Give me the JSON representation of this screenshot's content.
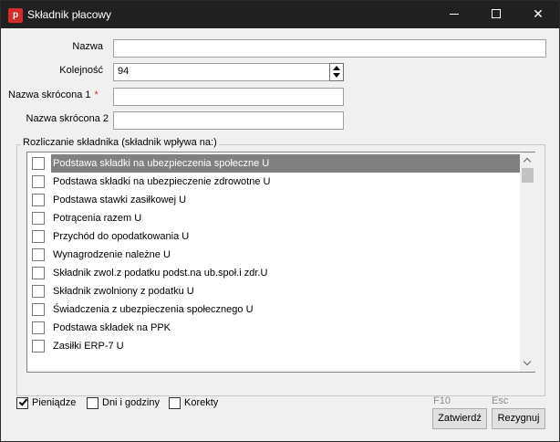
{
  "window": {
    "title": "Składnik płacowy",
    "icon_letter": "p",
    "controls": [
      "minimize-icon",
      "maximize-icon",
      "close-icon"
    ]
  },
  "form": {
    "nazwa": {
      "label": "Nazwa",
      "value": ""
    },
    "kolejnosc": {
      "label": "Kolejność",
      "value": "94"
    },
    "nazwa_skrocona_1": {
      "label": "Nazwa skrócona 1",
      "required_mark": "*",
      "value": ""
    },
    "nazwa_skrocona_2": {
      "label": "Nazwa skrócona 2",
      "value": ""
    }
  },
  "group": {
    "title": "Rozliczanie składnika (składnik wpływa na:)",
    "items": [
      {
        "label": "Podstawa składki na ubezpieczenia społeczne U",
        "checked": false,
        "selected": true
      },
      {
        "label": "Podstawa składki na ubezpieczenie zdrowotne U",
        "checked": false
      },
      {
        "label": "Podstawa stawki zasiłkowej U",
        "checked": false
      },
      {
        "label": "Potrącenia razem U",
        "checked": false
      },
      {
        "label": "Przychód do opodatkowania U",
        "checked": false
      },
      {
        "label": "Wynagrodzenie należne U",
        "checked": false
      },
      {
        "label": "Składnik zwol.z podatku podst.na ub.społ.i zdr.U",
        "checked": false
      },
      {
        "label": "Składnik zwolniony z podatku U",
        "checked": false
      },
      {
        "label": "Świadczenia z ubezpieczenia społecznego U",
        "checked": false
      },
      {
        "label": "Podstawa składek na PPK",
        "checked": false
      },
      {
        "label": "Zasiłki ERP-7 U",
        "checked": false
      }
    ]
  },
  "bottom": {
    "checkboxes": [
      {
        "label": "Pieniądze",
        "checked": true
      },
      {
        "label": "Dni i godziny",
        "checked": false
      },
      {
        "label": "Korekty",
        "checked": false
      }
    ],
    "confirm": {
      "hotkey": "F10",
      "label": "Zatwierdź"
    },
    "cancel": {
      "hotkey": "Esc",
      "label": "Rezygnuj"
    }
  },
  "colors": {
    "titlebar": "#202020",
    "selection": "#808080",
    "required": "#d42b2b"
  }
}
